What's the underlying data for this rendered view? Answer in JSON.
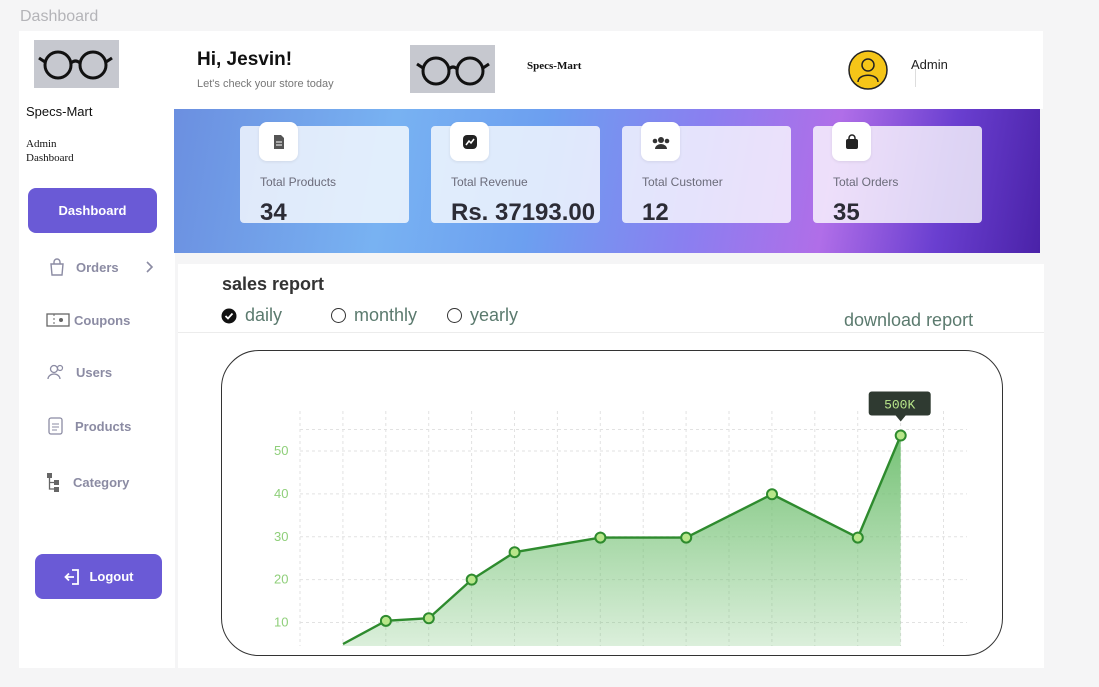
{
  "frame_label": "Dashboard",
  "sidebar": {
    "brand": "Specs-Mart",
    "subtitle_line1": "Admin",
    "subtitle_line2": "Dashboard",
    "active_item": "Dashboard",
    "items": [
      {
        "label": "Orders",
        "icon": "bag-icon"
      },
      {
        "label": "Coupons",
        "icon": "coupon-icon"
      },
      {
        "label": "Users",
        "icon": "users-icon"
      },
      {
        "label": "Products",
        "icon": "document-icon"
      },
      {
        "label": "Category",
        "icon": "tree-icon"
      }
    ],
    "logout": "Logout"
  },
  "header": {
    "greeting": "Hi, Jesvin!",
    "subgreeting": "Let's check your store today",
    "brand": "Specs-Mart",
    "user": "Admin"
  },
  "stats": [
    {
      "label": "Total Products",
      "value": "34",
      "icon": "file-icon"
    },
    {
      "label": "Total Revenue",
      "value": "Rs. 37193.00",
      "icon": "trend-icon"
    },
    {
      "label": "Total Customer",
      "value": "12",
      "icon": "group-icon"
    },
    {
      "label": "Total Orders",
      "value": "35",
      "icon": "shopping-bag-icon"
    }
  ],
  "report": {
    "title": "sales report",
    "tabs": [
      "daily",
      "monthly",
      "yearly"
    ],
    "selected_tab": "daily",
    "download": "download report"
  },
  "colors": {
    "accent": "#6a5ad6",
    "chart_line": "#2e8b2e",
    "chart_fill": "#6fbf6f"
  },
  "chart_data": {
    "type": "area",
    "y_ticks": [
      "10",
      "20",
      "30",
      "40",
      "50"
    ],
    "ylim": [
      5,
      55
    ],
    "x": [
      0,
      1,
      2,
      3,
      4,
      5,
      6,
      7,
      8,
      9,
      10,
      11,
      12,
      13
    ],
    "values": [
      5,
      10.4,
      11,
      20,
      26.4,
      null,
      29.8,
      null,
      29.8,
      null,
      39.9,
      null,
      29.8,
      53.6
    ],
    "marked_points": [
      1,
      2,
      3,
      4,
      6,
      8,
      10,
      12,
      13
    ],
    "annotation": {
      "text": "500K",
      "point_index": 13
    }
  }
}
